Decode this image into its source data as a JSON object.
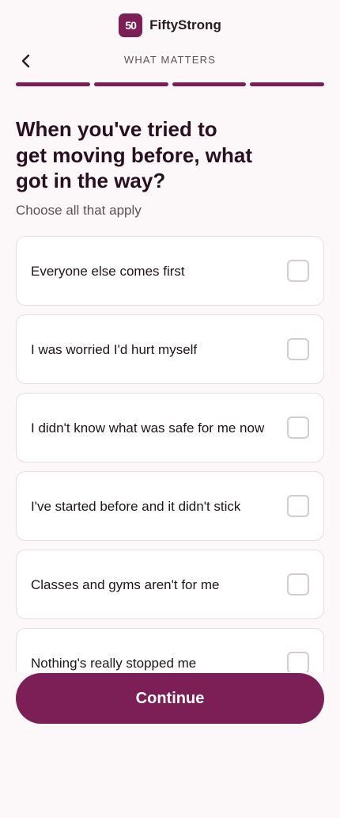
{
  "brand": {
    "logo_text": "50",
    "name": "FiftyStrong"
  },
  "header": {
    "step_title": "WHAT MATTERS",
    "back_icon": "chevron-left-icon"
  },
  "progress": {
    "segments_total": 4,
    "segments_complete": 4
  },
  "question": {
    "title": "When you've tried to get moving before, what got in the way?",
    "hint": "Choose all that apply"
  },
  "options": [
    {
      "label": "Everyone else comes first",
      "checked": false
    },
    {
      "label": "I was worried I'd hurt myself",
      "checked": false
    },
    {
      "label": "I didn't know what was safe for me now",
      "checked": false
    },
    {
      "label": "I've started before and it didn't stick",
      "checked": false
    },
    {
      "label": "Classes and gyms aren't for me",
      "checked": false
    },
    {
      "label": "Nothing's really stopped me",
      "checked": false
    }
  ],
  "footer": {
    "continue_label": "Continue"
  },
  "colors": {
    "accent": "#7d1f57",
    "background": "#fcf8f9",
    "text": "#2a0f20"
  }
}
